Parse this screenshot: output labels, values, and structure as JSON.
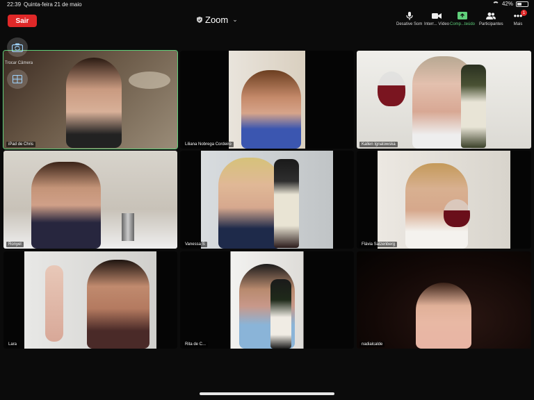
{
  "status": {
    "time": "22:39",
    "date": "Quinta-feira 21 de maio",
    "battery": "42%",
    "battery_level": 0.42
  },
  "topbar": {
    "leave_label": "Sair",
    "title": "Zoom",
    "mute_label": "Desative Som",
    "video_label": "Interr... Vídeo",
    "share_label": "Comp...teúdo",
    "participants_label": "Participantes",
    "more_label": "Mais",
    "more_badge": "1"
  },
  "floating": {
    "camera_label": "Trocar Câmera"
  },
  "colors": {
    "leave": "#e02828",
    "active_speaker": "#5fd07a",
    "share": "#5fcf7a"
  },
  "tiles": [
    {
      "name": "iPad de Chris"
    },
    {
      "name": "Liliana Nobrega Cordeiro"
    },
    {
      "name": "Kallen Ignatowska"
    },
    {
      "name": "Ronyel"
    },
    {
      "name": "Vanessa S"
    },
    {
      "name": "Flávia Salzenberg"
    },
    {
      "name": "Lara"
    },
    {
      "name": "Rita de C..."
    },
    {
      "name": "nadialcalde"
    }
  ]
}
